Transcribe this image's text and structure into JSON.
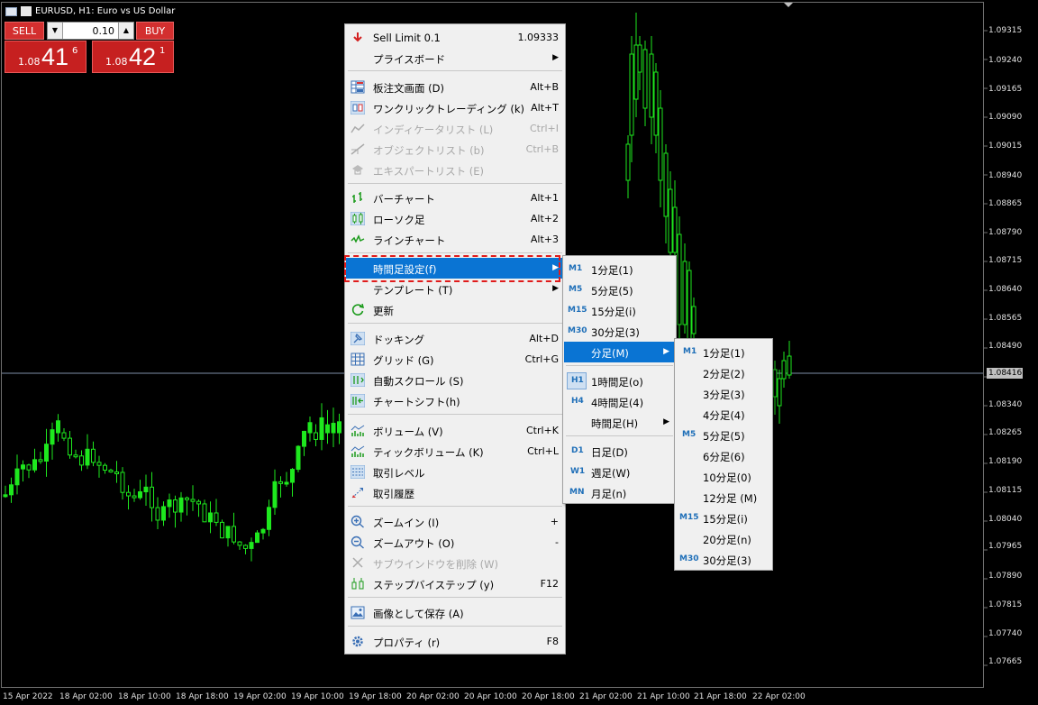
{
  "window": {
    "title": "EURUSD, H1:  Euro vs US Dollar"
  },
  "trade_panel": {
    "sell_label": "SELL",
    "buy_label": "BUY",
    "lot_value": "0.10",
    "sell_price": {
      "prefix": "1.08",
      "big": "41",
      "sup": "6"
    },
    "buy_price": {
      "prefix": "1.08",
      "big": "42",
      "sup": "1"
    }
  },
  "price_axis": [
    "1.09315",
    "1.09240",
    "1.09165",
    "1.09090",
    "1.09015",
    "1.08940",
    "1.08865",
    "1.08790",
    "1.08715",
    "1.08640",
    "1.08565",
    "1.08490",
    "1.08340",
    "1.08265",
    "1.08190",
    "1.08115",
    "1.08040",
    "1.07965",
    "1.07890",
    "1.07815",
    "1.07740",
    "1.07665"
  ],
  "current_price": "1.08416",
  "time_axis": [
    "15 Apr 2022",
    "18 Apr 02:00",
    "18 Apr 10:00",
    "18 Apr 18:00",
    "19 Apr 02:00",
    "19 Apr 10:00",
    "19 Apr 18:00",
    "20 Apr 02:00",
    "20 Apr 10:00",
    "20 Apr 18:00",
    "21 Apr 02:00",
    "21 Apr 10:00",
    "21 Apr 18:00",
    "22 Apr 02:00"
  ],
  "context_menu": {
    "sell_limit": {
      "label": "Sell Limit 0.1",
      "value": "1.09333"
    },
    "price_board": "プライスボード",
    "dom": {
      "label": "板注文画面 (D)",
      "shortcut": "Alt+B"
    },
    "one_click": {
      "label": "ワンクリックトレーディング (k)",
      "shortcut": "Alt+T"
    },
    "indicator_list": {
      "label": "インディケータリスト (L)",
      "shortcut": "Ctrl+I"
    },
    "object_list": {
      "label": "オブジェクトリスト (b)",
      "shortcut": "Ctrl+B"
    },
    "expert_list": {
      "label": "エキスパートリスト (E)"
    },
    "bar_chart": {
      "label": "バーチャート",
      "shortcut": "Alt+1"
    },
    "candle": {
      "label": "ローソク足",
      "shortcut": "Alt+2"
    },
    "line_chart": {
      "label": "ラインチャート",
      "shortcut": "Alt+3"
    },
    "timeframes": "時間足設定(f)",
    "template": "テンプレート (T)",
    "refresh": "更新",
    "docking": {
      "label": "ドッキング",
      "shortcut": "Alt+D"
    },
    "grid": {
      "label": "グリッド (G)",
      "shortcut": "Ctrl+G"
    },
    "autoscroll": {
      "label": "自動スクロール (S)"
    },
    "chart_shift": {
      "label": "チャートシフト(h)"
    },
    "volume": {
      "label": "ボリューム (V)",
      "shortcut": "Ctrl+K"
    },
    "tick_volume": {
      "label": "ティックボリューム (K)",
      "shortcut": "Ctrl+L"
    },
    "trade_levels": {
      "label": "取引レベル"
    },
    "trade_history": {
      "label": "取引履歴"
    },
    "zoom_in": {
      "label": "ズームイン (I)",
      "shortcut": "+"
    },
    "zoom_out": {
      "label": "ズームアウト (O)",
      "shortcut": "-"
    },
    "delete_subwindow": {
      "label": "サブウインドウを削除 (W)"
    },
    "step": {
      "label": "ステップバイステップ (y)",
      "shortcut": "F12"
    },
    "save_image": {
      "label": "画像として保存 (A)"
    },
    "properties": {
      "label": "プロパティ (r)",
      "shortcut": "F8"
    }
  },
  "timeframe_menu": [
    {
      "tag": "M1",
      "label": "1分足(1)"
    },
    {
      "tag": "M5",
      "label": "5分足(5)"
    },
    {
      "tag": "M15",
      "label": "15分足(i)"
    },
    {
      "tag": "M30",
      "label": "30分足(3)"
    },
    {
      "tag": "",
      "label": "分足(M)"
    },
    {
      "tag": "H1",
      "label": "1時間足(o)"
    },
    {
      "tag": "H4",
      "label": "4時間足(4)"
    },
    {
      "tag": "",
      "label": "時間足(H)"
    },
    {
      "tag": "D1",
      "label": "日足(D)"
    },
    {
      "tag": "W1",
      "label": "週足(W)"
    },
    {
      "tag": "MN",
      "label": "月足(n)"
    }
  ],
  "minutes_menu": [
    {
      "tag": "M1",
      "label": "1分足(1)"
    },
    {
      "tag": "",
      "label": "2分足(2)"
    },
    {
      "tag": "",
      "label": "3分足(3)"
    },
    {
      "tag": "",
      "label": "4分足(4)"
    },
    {
      "tag": "M5",
      "label": "5分足(5)"
    },
    {
      "tag": "",
      "label": "6分足(6)"
    },
    {
      "tag": "",
      "label": "10分足(0)"
    },
    {
      "tag": "",
      "label": "12分足 (M)"
    },
    {
      "tag": "M15",
      "label": "15分足(i)"
    },
    {
      "tag": "",
      "label": "20分足(n)"
    },
    {
      "tag": "M30",
      "label": "30分足(3)"
    }
  ],
  "colors": {
    "candle": "#1ee81e",
    "menu_bg": "#f0f0f0",
    "selection": "#0a74d3",
    "highlight_box": "#e01b1b",
    "sell_buy": "#d32f2f"
  }
}
